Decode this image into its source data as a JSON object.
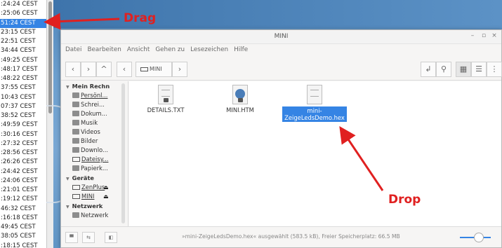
{
  "timelist": {
    "rows": [
      ":24:24 CEST",
      ":25:06 CEST",
      "51:24 CEST",
      "23:15 CEST",
      "22:51 CEST",
      "34:44 CEST",
      ":49:25 CEST",
      ":48:17 CEST",
      ":48:22 CEST",
      "37:55 CEST",
      "10:43 CEST",
      "07:37 CEST",
      "38:52 CEST",
      ":49:59 CEST",
      ":30:16 CEST",
      ":27:32 CEST",
      ":28:56 CEST",
      ":26:26 CEST",
      ":24:42 CEST",
      ":24:06 CEST",
      ":21:01 CEST",
      ":19:12 CEST",
      "46:32 CEST",
      ":16:18 CEST",
      "49:45 CEST",
      "38:05 CEST",
      ":18:15 CEST"
    ],
    "selected_index": 2
  },
  "annotations": {
    "drag": "Drag",
    "drop": "Drop",
    "color": "#e02020"
  },
  "window": {
    "title": "MINI",
    "minimize": "–",
    "maximize": "▫",
    "close": "×",
    "menu": [
      "Datei",
      "Bearbeiten",
      "Ansicht",
      "Gehen zu",
      "Lesezeichen",
      "Hilfe"
    ]
  },
  "toolbar": {
    "back": "‹",
    "forward": "›",
    "up": "^",
    "prev": "‹",
    "path_label": "MINI",
    "next": "›",
    "open_terminal": "↲",
    "search": "⚲",
    "view_icons": "▦",
    "view_list": "☰",
    "view_compact": "⋮"
  },
  "sidebar": {
    "mein_rechner": "Mein Rechn",
    "places": [
      {
        "label": "Persönl...",
        "underlined": true
      },
      {
        "label": "Schrei...",
        "underlined": false
      },
      {
        "label": "Dokum...",
        "underlined": false
      },
      {
        "label": "Musik",
        "underlined": false
      },
      {
        "label": "Videos",
        "underlined": false
      },
      {
        "label": "Bilder",
        "underlined": false
      },
      {
        "label": "Downlo...",
        "underlined": false
      },
      {
        "label": "Dateisy...",
        "underlined": true
      },
      {
        "label": "Papierk...",
        "underlined": false
      }
    ],
    "geraete": "Geräte",
    "devices": [
      {
        "label": "ZenPlus",
        "eject": "⏏"
      },
      {
        "label": "MINI",
        "eject": "⏏"
      }
    ],
    "netzwerk": "Netzwerk",
    "network_item": "Netzwerk"
  },
  "files": [
    {
      "name": "DETAILS.TXT",
      "icon": "text-file-locked-icon",
      "selected": false
    },
    {
      "name": "MINI.HTM",
      "icon": "html-file-icon",
      "selected": false
    },
    {
      "name": "mini-ZeigeLedsDemo.hex",
      "icon": "text-file-icon",
      "selected": true
    }
  ],
  "statusbar": {
    "text": "»mini-ZeigeLedsDemo.hex« ausgewählt (583.5 kB), Freier Speicherplatz: 66.5 MB",
    "btn1": "▀",
    "btn2": "⇆",
    "btn3": "◧"
  }
}
